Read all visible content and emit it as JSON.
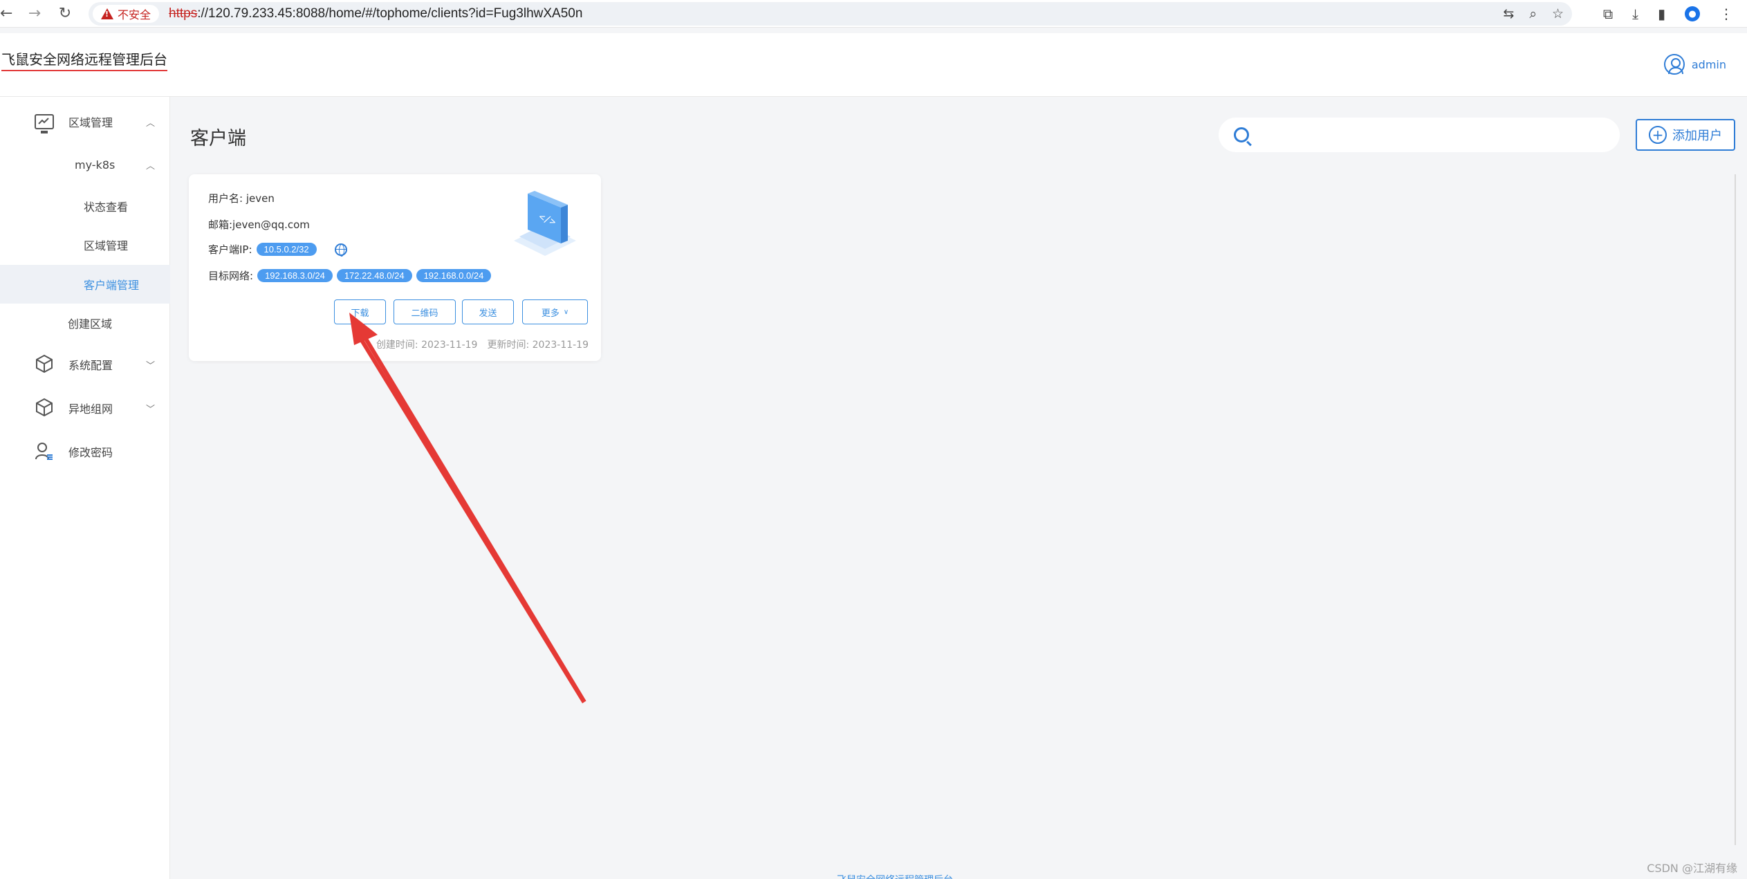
{
  "browser": {
    "security_label": "不安全",
    "url_scheme": "https",
    "url_rest": "://120.79.233.45:8088/home/#/tophome/clients?id=Fug3lhwXA50n"
  },
  "header": {
    "brand": "飞鼠安全网络远程管理后台",
    "username": "admin"
  },
  "sidebar": {
    "items": [
      {
        "label": "区域管理",
        "caret": "^"
      },
      {
        "label": "my-k8s",
        "caret": "^"
      },
      {
        "label": "状态查看"
      },
      {
        "label": "区域管理"
      },
      {
        "label": "客户端管理"
      },
      {
        "label": "创建区域"
      },
      {
        "label": "系统配置",
        "caret": "v"
      },
      {
        "label": "异地组网",
        "caret": "v"
      },
      {
        "label": "修改密码"
      }
    ]
  },
  "main": {
    "title": "客户端",
    "search_placeholder": "",
    "add_user_label": "添加用户"
  },
  "card": {
    "username_label": "用户名: jeven",
    "email_label": "邮箱:jeven@qq.com",
    "client_ip_label": "客户端IP:",
    "client_ip": "10.5.0.2/32",
    "target_network_label": "目标网络:",
    "target_networks": [
      "192.168.3.0/24",
      "172.22.48.0/24",
      "192.168.0.0/24"
    ],
    "actions": {
      "download": "下载",
      "qrcode": "二维码",
      "send": "发送",
      "more": "更多"
    },
    "created": "创建时间: 2023-11-19",
    "updated": "更新时间: 2023-11-19"
  },
  "footer_partial": "飞鼠安全网络远程管理后台",
  "watermark": "CSDN @江湖有缘",
  "colors": {
    "accent": "#2e7cd6",
    "tag": "#4d9cf0",
    "annotation": "#e53935"
  }
}
